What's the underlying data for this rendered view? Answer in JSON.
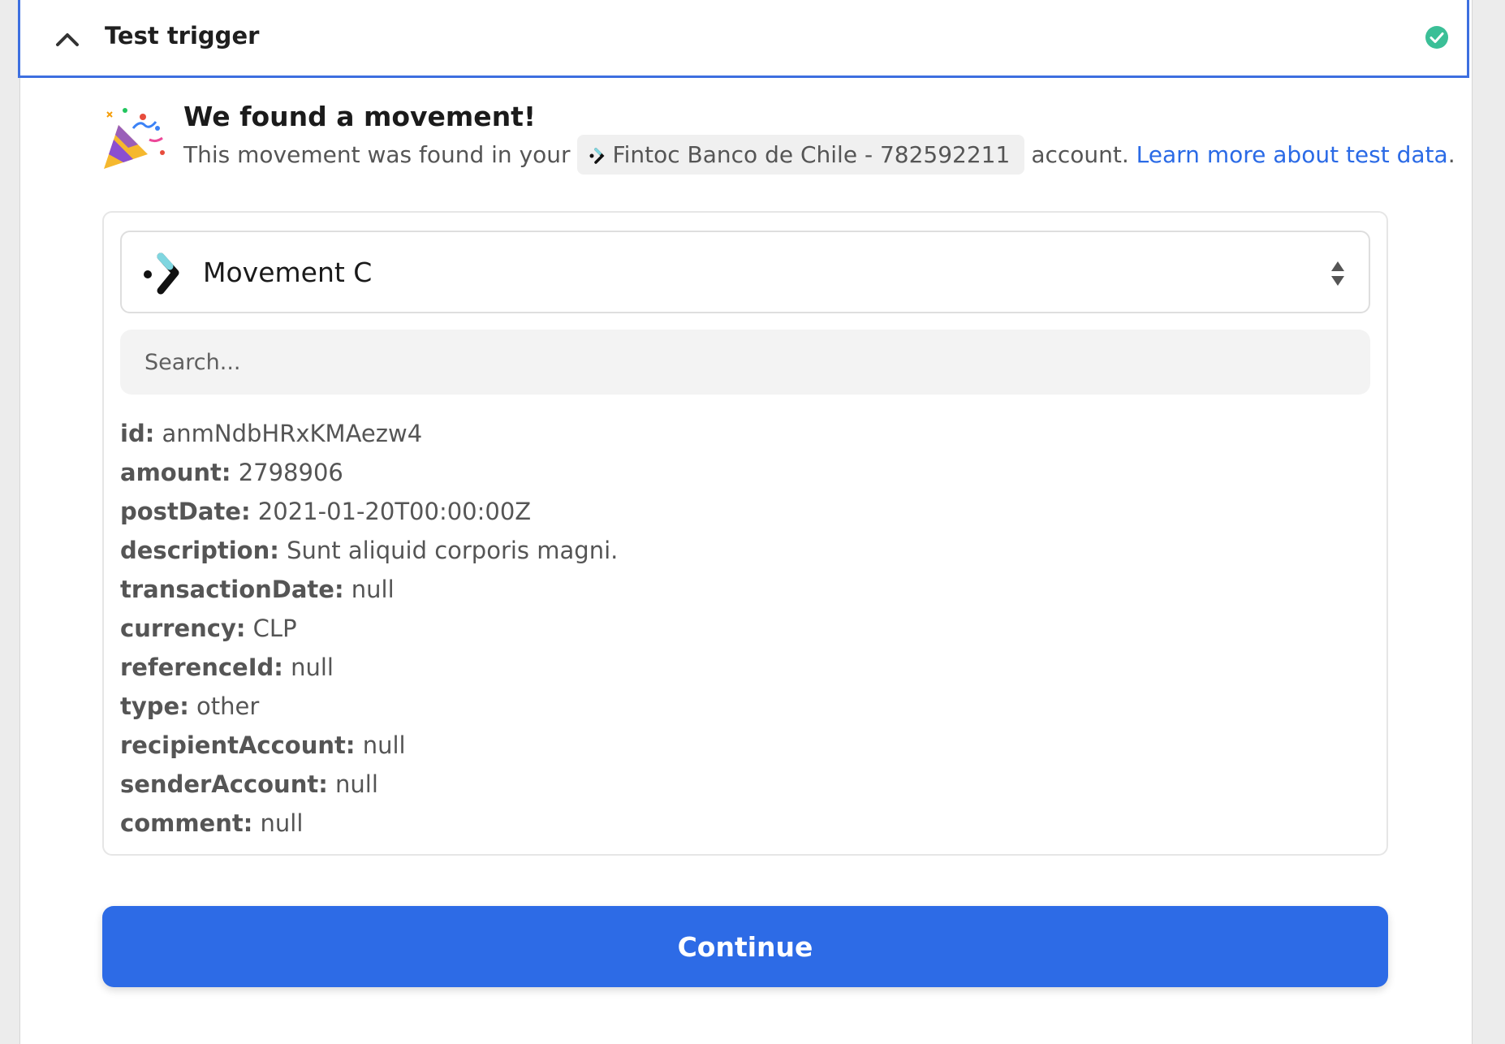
{
  "header": {
    "title": "Test trigger",
    "collapse_icon": "chevron-up-icon",
    "status_icon": "check-circle-icon",
    "status_color": "#3bbf97"
  },
  "found": {
    "title": "We found a movement!",
    "icon": "party-popper-icon",
    "sub_before": "This movement was found in your",
    "account_label": "Fintoc Banco de Chile - 782592211",
    "sub_after": "account.",
    "learn_link": "Learn more about test data",
    "trailing": "."
  },
  "selector": {
    "label": "Movement C",
    "icon": "fintoc-logo-icon"
  },
  "search": {
    "placeholder": "Search..."
  },
  "fields": [
    {
      "key": "id:",
      "value": "anmNdbHRxKMAezw4"
    },
    {
      "key": "amount:",
      "value": "2798906"
    },
    {
      "key": "postDate:",
      "value": "2021-01-20T00:00:00Z"
    },
    {
      "key": "description:",
      "value": "Sunt aliquid corporis magni."
    },
    {
      "key": "transactionDate:",
      "value": "null"
    },
    {
      "key": "currency:",
      "value": "CLP"
    },
    {
      "key": "referenceId:",
      "value": "null"
    },
    {
      "key": "type:",
      "value": "other"
    },
    {
      "key": "recipientAccount:",
      "value": "null"
    },
    {
      "key": "senderAccount:",
      "value": "null"
    },
    {
      "key": "comment:",
      "value": "null"
    }
  ],
  "actions": {
    "continue_label": "Continue"
  },
  "colors": {
    "accent": "#2d6be6",
    "link": "#2a6ae6",
    "header_border": "#3d6fe0"
  }
}
